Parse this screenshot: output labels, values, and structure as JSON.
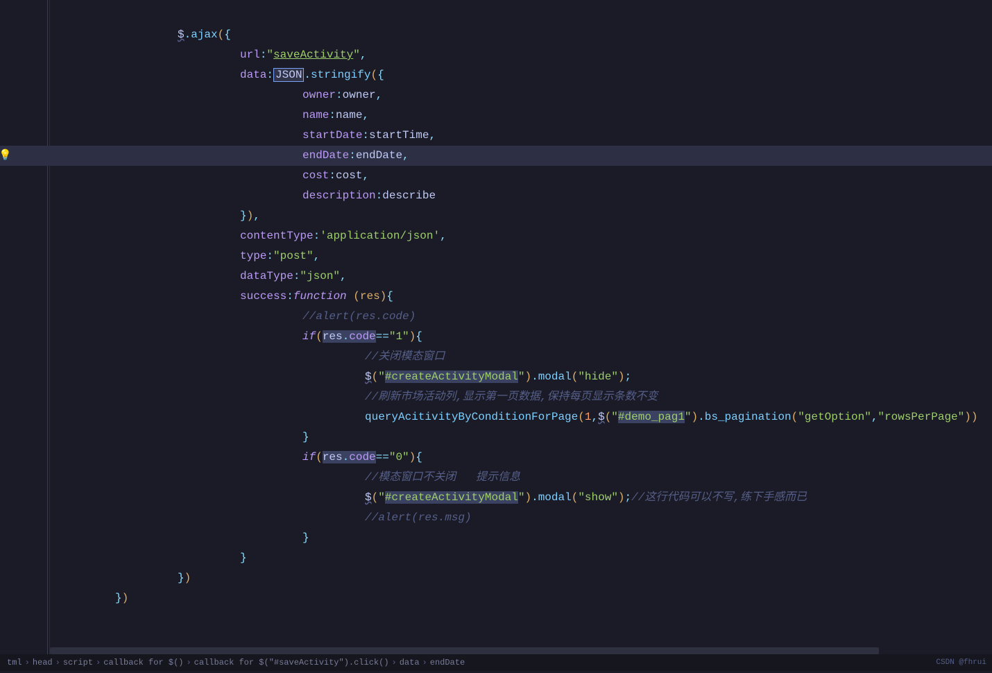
{
  "bulb_icon": "💡",
  "code_lines": [
    {
      "indent": 2,
      "tokens": [
        {
          "t": "$",
          "c": "t-var wavy"
        },
        {
          "t": ".",
          "c": "t-punc"
        },
        {
          "t": "ajax",
          "c": "t-func"
        },
        {
          "t": "(",
          "c": "t-punc2"
        },
        {
          "t": "{",
          "c": "t-punc"
        }
      ]
    },
    {
      "indent": 3,
      "tokens": [
        {
          "t": "url",
          "c": "t-prop"
        },
        {
          "t": ":",
          "c": "t-punc"
        },
        {
          "t": "\"",
          "c": "t-str"
        },
        {
          "t": "saveActivity",
          "c": "t-str underline"
        },
        {
          "t": "\"",
          "c": "t-str"
        },
        {
          "t": ",",
          "c": "t-punc"
        }
      ]
    },
    {
      "indent": 3,
      "tokens": [
        {
          "t": "data",
          "c": "t-prop"
        },
        {
          "t": ":",
          "c": "t-punc"
        },
        {
          "t": "JSON",
          "c": "t-var box-json"
        },
        {
          "t": ".",
          "c": "t-punc"
        },
        {
          "t": "stringify",
          "c": "t-func"
        },
        {
          "t": "(",
          "c": "t-punc2"
        },
        {
          "t": "{",
          "c": "t-punc"
        }
      ]
    },
    {
      "indent": 4,
      "tokens": [
        {
          "t": "owner",
          "c": "t-prop"
        },
        {
          "t": ":",
          "c": "t-punc"
        },
        {
          "t": "owner",
          "c": "t-var"
        },
        {
          "t": ",",
          "c": "t-punc"
        }
      ]
    },
    {
      "indent": 4,
      "tokens": [
        {
          "t": "name",
          "c": "t-prop"
        },
        {
          "t": ":",
          "c": "t-punc"
        },
        {
          "t": "name",
          "c": "t-var"
        },
        {
          "t": ",",
          "c": "t-punc"
        }
      ]
    },
    {
      "indent": 4,
      "tokens": [
        {
          "t": "startDate",
          "c": "t-prop"
        },
        {
          "t": ":",
          "c": "t-punc"
        },
        {
          "t": "startTime",
          "c": "t-var"
        },
        {
          "t": ",",
          "c": "t-punc"
        }
      ]
    },
    {
      "indent": 4,
      "hl": true,
      "tokens": [
        {
          "t": "endDate",
          "c": "t-prop"
        },
        {
          "t": ":",
          "c": "t-punc"
        },
        {
          "t": "endDate",
          "c": "t-var"
        },
        {
          "t": ",",
          "c": "t-punc"
        }
      ]
    },
    {
      "indent": 4,
      "tokens": [
        {
          "t": "cost",
          "c": "t-prop"
        },
        {
          "t": ":",
          "c": "t-punc"
        },
        {
          "t": "cost",
          "c": "t-var"
        },
        {
          "t": ",",
          "c": "t-punc"
        }
      ]
    },
    {
      "indent": 4,
      "tokens": [
        {
          "t": "description",
          "c": "t-prop"
        },
        {
          "t": ":",
          "c": "t-punc"
        },
        {
          "t": "describe",
          "c": "t-var"
        }
      ]
    },
    {
      "indent": 3,
      "tokens": [
        {
          "t": "}",
          "c": "t-punc"
        },
        {
          "t": ")",
          "c": "t-punc2"
        },
        {
          "t": ",",
          "c": "t-punc"
        }
      ]
    },
    {
      "indent": 3,
      "tokens": [
        {
          "t": "contentType",
          "c": "t-prop"
        },
        {
          "t": ":",
          "c": "t-punc"
        },
        {
          "t": "'application/json'",
          "c": "t-str"
        },
        {
          "t": ",",
          "c": "t-punc"
        }
      ]
    },
    {
      "indent": 3,
      "tokens": [
        {
          "t": "type",
          "c": "t-prop"
        },
        {
          "t": ":",
          "c": "t-punc"
        },
        {
          "t": "\"post\"",
          "c": "t-str"
        },
        {
          "t": ",",
          "c": "t-punc"
        }
      ]
    },
    {
      "indent": 3,
      "tokens": [
        {
          "t": "dataType",
          "c": "t-prop"
        },
        {
          "t": ":",
          "c": "t-punc"
        },
        {
          "t": "\"json\"",
          "c": "t-str"
        },
        {
          "t": ",",
          "c": "t-punc"
        }
      ]
    },
    {
      "indent": 3,
      "tokens": [
        {
          "t": "success",
          "c": "t-prop"
        },
        {
          "t": ":",
          "c": "t-punc"
        },
        {
          "t": "function ",
          "c": "t-kw"
        },
        {
          "t": "(",
          "c": "t-punc2"
        },
        {
          "t": "res",
          "c": "t-param"
        },
        {
          "t": ")",
          "c": "t-punc2"
        },
        {
          "t": "{",
          "c": "t-punc"
        }
      ]
    },
    {
      "indent": 4,
      "tokens": [
        {
          "t": "//alert(res.code)",
          "c": "t-comment"
        }
      ]
    },
    {
      "indent": 4,
      "tokens": [
        {
          "t": "if",
          "c": "t-kw"
        },
        {
          "t": "(",
          "c": "t-punc2"
        },
        {
          "t": "res",
          "c": "t-var hl-sel"
        },
        {
          "t": ".",
          "c": "t-punc hl-sel"
        },
        {
          "t": "code",
          "c": "t-prop hl-sel"
        },
        {
          "t": "==",
          "c": "t-punc"
        },
        {
          "t": "\"1\"",
          "c": "t-str"
        },
        {
          "t": ")",
          "c": "t-punc2"
        },
        {
          "t": "{",
          "c": "t-punc"
        }
      ]
    },
    {
      "indent": 5,
      "tokens": [
        {
          "t": "//",
          "c": "t-comment"
        },
        {
          "t": "关闭模态窗口",
          "c": "t-comment"
        }
      ]
    },
    {
      "indent": 5,
      "tokens": [
        {
          "t": "$",
          "c": "t-var wavy"
        },
        {
          "t": "(",
          "c": "t-punc2"
        },
        {
          "t": "\"",
          "c": "t-str"
        },
        {
          "t": "#createActivityModal",
          "c": "t-str hl-sel"
        },
        {
          "t": "\"",
          "c": "t-str"
        },
        {
          "t": ")",
          "c": "t-punc2"
        },
        {
          "t": ".",
          "c": "t-punc"
        },
        {
          "t": "modal",
          "c": "t-func"
        },
        {
          "t": "(",
          "c": "t-punc2"
        },
        {
          "t": "\"hide\"",
          "c": "t-str"
        },
        {
          "t": ")",
          "c": "t-punc2"
        },
        {
          "t": ";",
          "c": "t-punc"
        }
      ]
    },
    {
      "indent": 5,
      "tokens": [
        {
          "t": "//",
          "c": "t-comment"
        },
        {
          "t": "刷新市场活动列,显示第一页数据,保持每页显示条数不变",
          "c": "t-comment"
        }
      ]
    },
    {
      "indent": 5,
      "tokens": [
        {
          "t": "queryAcitivityByConditionForPage",
          "c": "t-func"
        },
        {
          "t": "(",
          "c": "t-punc2"
        },
        {
          "t": "1",
          "c": "t-num"
        },
        {
          "t": ",",
          "c": "t-punc"
        },
        {
          "t": "$",
          "c": "t-var wavy"
        },
        {
          "t": "(",
          "c": "t-punc2"
        },
        {
          "t": "\"",
          "c": "t-str"
        },
        {
          "t": "#demo_pag1",
          "c": "t-str hl-sel"
        },
        {
          "t": "\"",
          "c": "t-str"
        },
        {
          "t": ")",
          "c": "t-punc2"
        },
        {
          "t": ".",
          "c": "t-punc"
        },
        {
          "t": "bs_pagination",
          "c": "t-func"
        },
        {
          "t": "(",
          "c": "t-punc2"
        },
        {
          "t": "\"getOption\"",
          "c": "t-str"
        },
        {
          "t": ",",
          "c": "t-punc"
        },
        {
          "t": "\"rowsPerPage\"",
          "c": "t-str"
        },
        {
          "t": ")",
          "c": "t-punc2"
        },
        {
          "t": ")",
          "c": "t-punc2"
        }
      ]
    },
    {
      "indent": 4,
      "tokens": [
        {
          "t": "}",
          "c": "t-punc"
        }
      ]
    },
    {
      "indent": 4,
      "tokens": [
        {
          "t": "if",
          "c": "t-kw"
        },
        {
          "t": "(",
          "c": "t-punc2"
        },
        {
          "t": "res",
          "c": "t-var hl-sel"
        },
        {
          "t": ".",
          "c": "t-punc hl-sel"
        },
        {
          "t": "code",
          "c": "t-prop hl-sel"
        },
        {
          "t": "==",
          "c": "t-punc"
        },
        {
          "t": "\"0\"",
          "c": "t-str"
        },
        {
          "t": ")",
          "c": "t-punc2"
        },
        {
          "t": "{",
          "c": "t-punc"
        }
      ]
    },
    {
      "indent": 5,
      "tokens": [
        {
          "t": "//",
          "c": "t-comment"
        },
        {
          "t": "模态窗口不关闭   提示信息",
          "c": "t-comment"
        }
      ]
    },
    {
      "indent": 5,
      "tokens": [
        {
          "t": "$",
          "c": "t-var wavy"
        },
        {
          "t": "(",
          "c": "t-punc2"
        },
        {
          "t": "\"",
          "c": "t-str"
        },
        {
          "t": "#createActivityModal",
          "c": "t-str hl-sel"
        },
        {
          "t": "\"",
          "c": "t-str"
        },
        {
          "t": ")",
          "c": "t-punc2"
        },
        {
          "t": ".",
          "c": "t-punc"
        },
        {
          "t": "modal",
          "c": "t-func"
        },
        {
          "t": "(",
          "c": "t-punc2"
        },
        {
          "t": "\"show\"",
          "c": "t-str"
        },
        {
          "t": ")",
          "c": "t-punc2"
        },
        {
          "t": ";",
          "c": "t-punc"
        },
        {
          "t": "//",
          "c": "t-comment"
        },
        {
          "t": "这行代码可以不写,练下手感而已",
          "c": "t-comment"
        }
      ]
    },
    {
      "indent": 5,
      "tokens": [
        {
          "t": "//alert(res.msg)",
          "c": "t-comment"
        }
      ]
    },
    {
      "indent": 4,
      "tokens": [
        {
          "t": "}",
          "c": "t-punc"
        }
      ]
    },
    {
      "indent": 3,
      "tokens": [
        {
          "t": "}",
          "c": "t-punc"
        }
      ]
    },
    {
      "indent": 2,
      "tokens": [
        {
          "t": "}",
          "c": "t-punc"
        },
        {
          "t": ")",
          "c": "t-punc2"
        }
      ]
    },
    {
      "indent": 1,
      "tokens": [
        {
          "t": "}",
          "c": "t-punc"
        },
        {
          "t": ")",
          "c": "t-punc2"
        }
      ]
    }
  ],
  "breadcrumb": {
    "items": [
      "tml",
      "head",
      "script",
      "callback for $()",
      "callback for $(\"#saveActivity\").click()",
      "data",
      "endDate"
    ],
    "watermark": "CSDN @fhrui"
  },
  "indent_width": 45
}
